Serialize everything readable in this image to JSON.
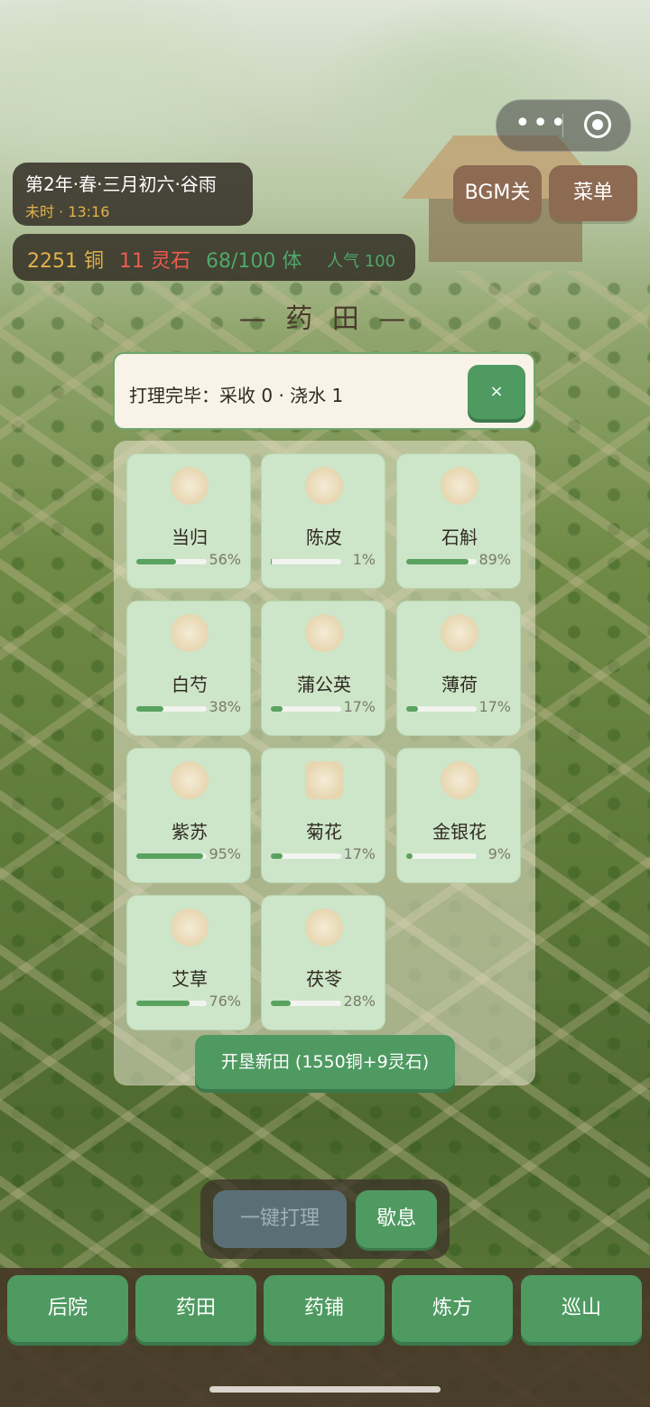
{
  "status": {
    "date": "第2年·春·三月初六·谷雨",
    "time": "未时 · 13:16",
    "copper": "2251 铜",
    "spirit_stone": "11 灵石",
    "stamina": "68/100 体",
    "popularity": "人气 100"
  },
  "top_buttons": {
    "bgm": "BGM关",
    "menu": "菜单"
  },
  "capsule": {
    "more": "•••"
  },
  "page_title": "— 药 田 —",
  "toast": {
    "message": "打理完毕：采收 0 · 浇水 1",
    "close": "×"
  },
  "plots": [
    {
      "name": "当归",
      "progress": 56,
      "progress_label": "56%",
      "icon": "herb-angelica-icon"
    },
    {
      "name": "陈皮",
      "progress": 1,
      "progress_label": "1%",
      "icon": "herb-tangerine-peel-icon"
    },
    {
      "name": "石斛",
      "progress": 89,
      "progress_label": "89%",
      "icon": "herb-dendrobium-icon"
    },
    {
      "name": "白芍",
      "progress": 38,
      "progress_label": "38%",
      "icon": "herb-white-peony-icon"
    },
    {
      "name": "蒲公英",
      "progress": 17,
      "progress_label": "17%",
      "icon": "herb-dandelion-icon"
    },
    {
      "name": "薄荷",
      "progress": 17,
      "progress_label": "17%",
      "icon": "herb-mint-icon"
    },
    {
      "name": "紫苏",
      "progress": 95,
      "progress_label": "95%",
      "icon": "herb-perilla-icon"
    },
    {
      "name": "菊花",
      "progress": 17,
      "progress_label": "17%",
      "icon": "herb-chrysanthemum-icon"
    },
    {
      "name": "金银花",
      "progress": 9,
      "progress_label": "9%",
      "icon": "herb-honeysuckle-icon"
    },
    {
      "name": "艾草",
      "progress": 76,
      "progress_label": "76%",
      "icon": "herb-mugwort-icon"
    },
    {
      "name": "茯苓",
      "progress": 28,
      "progress_label": "28%",
      "icon": "herb-poria-icon"
    }
  ],
  "reclaim_button": "开垦新田 (1550铜+9灵石)",
  "actions": {
    "one_click": "一键打理",
    "rest": "歇息"
  },
  "nav": [
    "后院",
    "药田",
    "药铺",
    "炼方",
    "巡山"
  ],
  "colors": {
    "accent_green": "#4f9a61",
    "copper": "#e2b24c",
    "stone": "#ef5b4e",
    "stamina": "#4fa86a",
    "brown_button": "#8d6b52"
  }
}
